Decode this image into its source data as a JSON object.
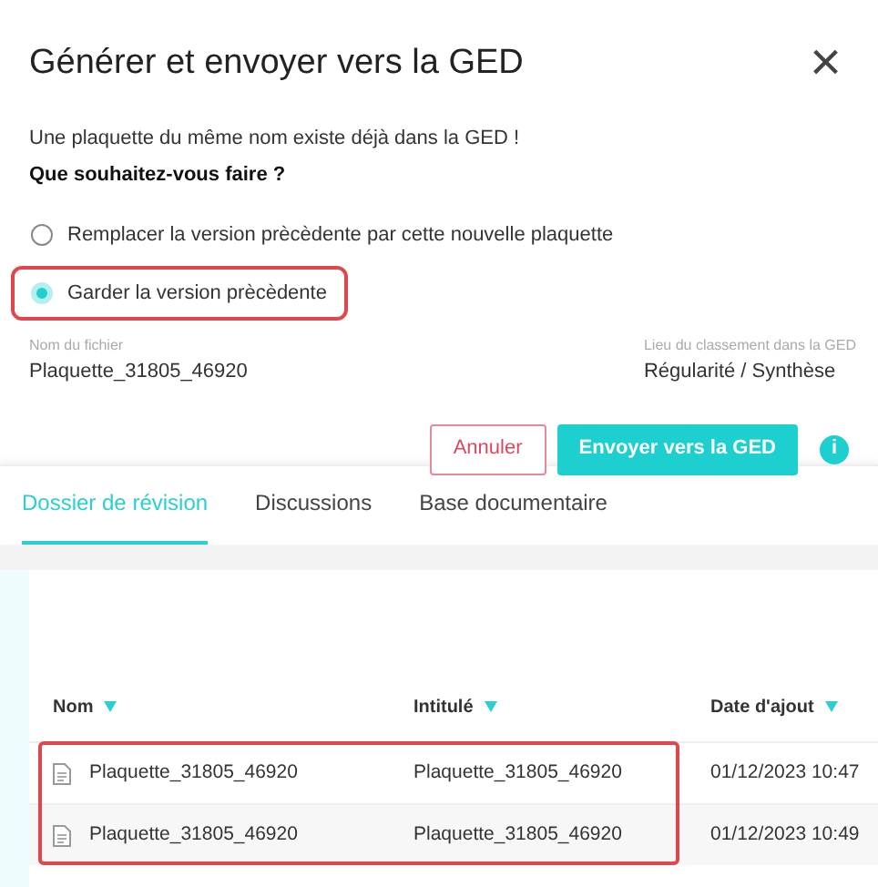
{
  "dialog": {
    "title": "Générer et envoyer vers la GED",
    "close": "×",
    "message": "Une plaquette du même nom existe déjà dans la GED !",
    "question": "Que souhaitez-vous faire ?",
    "options": [
      {
        "label": "Remplacer la version prècèdente par cette nouvelle plaquette",
        "selected": false,
        "highlighted": false
      },
      {
        "label": "Garder la version prècèdente",
        "selected": true,
        "highlighted": true
      }
    ],
    "file_name": {
      "label": "Nom du fichier",
      "value": "Plaquette_31805_46920"
    },
    "location": {
      "label": "Lieu du classement dans la GED",
      "value": "Régularité / Synthèse"
    },
    "buttons": [
      {
        "label": "Annuler",
        "kind": "secondary"
      },
      {
        "label": "Envoyer vers la GED",
        "kind": "primary"
      }
    ],
    "info": "i"
  },
  "tabs": [
    {
      "label": "Dossier de révision",
      "selected": true
    },
    {
      "label": "Discussions",
      "selected": false
    },
    {
      "label": "Base documentaire",
      "selected": false
    }
  ],
  "table": {
    "columns": [
      "Nom",
      "Intitulé",
      "Date d'ajout"
    ],
    "rows": [
      {
        "cells": [
          "Plaquette_31805_46920",
          "Plaquette_31805_46920",
          "01/12/2023 10:47"
        ],
        "highlighted": true
      },
      {
        "cells": [
          "Plaquette_31805_46920",
          "Plaquette_31805_46920",
          "01/12/2023 10:49"
        ],
        "highlighted": true
      }
    ]
  }
}
